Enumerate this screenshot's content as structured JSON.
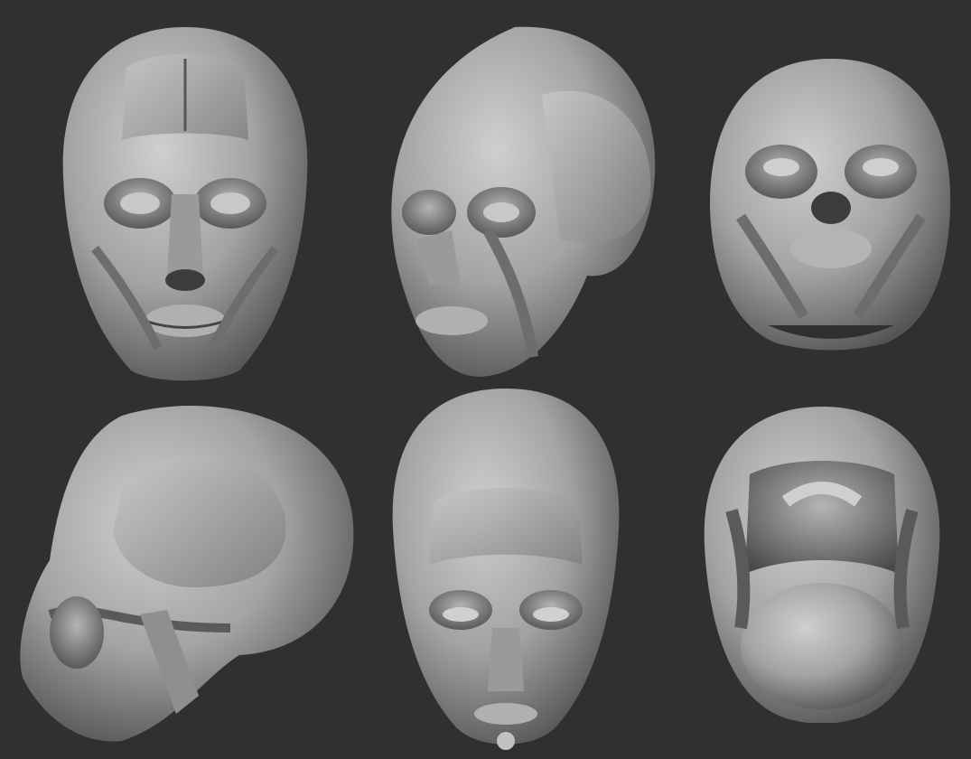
{
  "canvas": {
    "background": "#303030",
    "material_light": "#c4c4c4",
    "material_mid": "#8e8e8e",
    "material_dark": "#3a3a3a"
  },
  "views": [
    {
      "name": "front",
      "row": 1,
      "column": 1
    },
    {
      "name": "three-quarter",
      "row": 1,
      "column": 2
    },
    {
      "name": "low-front",
      "row": 1,
      "column": 3
    },
    {
      "name": "side",
      "row": 2,
      "column": 1
    },
    {
      "name": "top-front",
      "row": 2,
      "column": 2
    },
    {
      "name": "bottom",
      "row": 2,
      "column": 3
    }
  ]
}
